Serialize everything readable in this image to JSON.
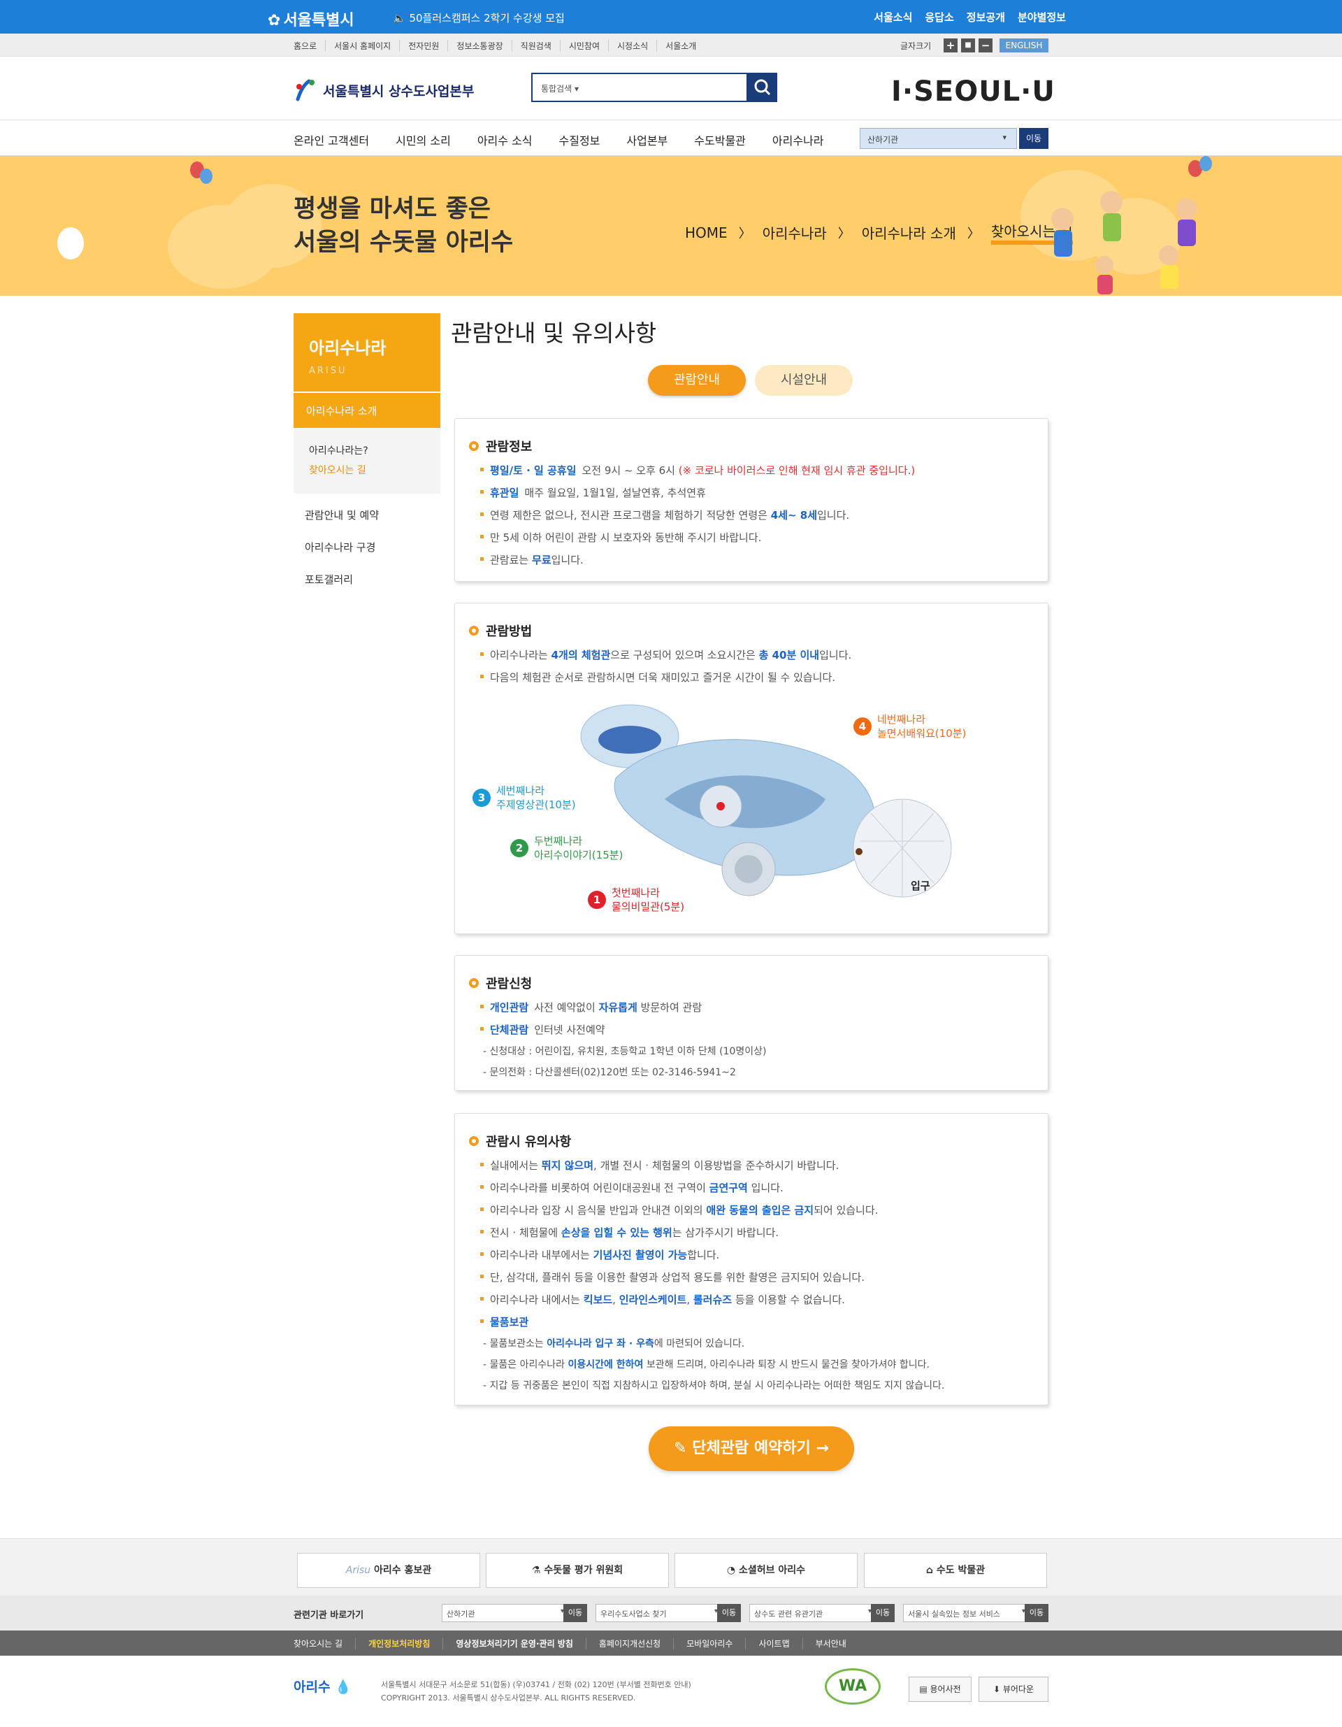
{
  "topbar": {
    "logo": "서울특별시",
    "notice": "50플러스캠퍼스 2학기 수강생 모집",
    "links": [
      "서울소식",
      "응답소",
      "정보공개",
      "분야별정보"
    ]
  },
  "utilbar": {
    "links": [
      "홈으로",
      "서울시 홈페이지",
      "전자민원",
      "정보소통광장",
      "직원검색",
      "시민참여",
      "시정소식",
      "서울소개"
    ],
    "font_size_label": "글자크기",
    "font_plus": "+",
    "font_reset": "■",
    "font_minus": "−",
    "english": "ENGLISH"
  },
  "header": {
    "org_title": "서울특별시 상수도사업본부",
    "search_scope": "통합검색",
    "brand": "I·SEOUL·U"
  },
  "gnb": {
    "items": [
      "온라인 고객센터",
      "시민의 소리",
      "아리수 소식",
      "수질정보",
      "사업본부",
      "수도박물관",
      "아리수나라"
    ],
    "org_select": "산하기관",
    "go": "이동"
  },
  "banner": {
    "slogan_line1": "평생을 마셔도 좋은",
    "slogan_line2": "서울의 수돗물 아리수",
    "breadcrumb": [
      "HOME",
      "아리수나라",
      "아리수나라 소개",
      "찾아오시는 길"
    ]
  },
  "lnb": {
    "title": "아리수나라",
    "subtitle": "ARISU",
    "active": "아리수나라 소개",
    "sub_items": [
      "아리수나라는?",
      "찾아오시는 길"
    ],
    "menu": [
      "관람안내 및 예약",
      "아리수나라 구경",
      "포토갤러리"
    ]
  },
  "content": {
    "page_title": "관람안내 및 유의사항",
    "tabs": [
      "관람안내",
      "시설안내"
    ],
    "info": {
      "title": "관람정보",
      "row1_label": "평일/토 · 일 공휴일",
      "row1_text": "오전 9시 ~ 오후 6시",
      "row1_note": "(※ 코로나 바이러스로 인해 현재 임시 휴관 중입니다.)",
      "row2_label": "휴관일",
      "row2_text": "매주 월요일, 1월1일, 설날연휴, 추석연휴",
      "row3_a": "연령 제한은 없으나, 전시관 프로그램을 체험하기 적당한 연령은",
      "row3_hl": "4세~ 8세",
      "row3_b": "입니다.",
      "row4": "만 5세 이하 어린이 관람 시 보호자와 동반해 주시기 바랍니다.",
      "row5_a": "관람료는",
      "row5_hl": "무료",
      "row5_b": "입니다."
    },
    "method": {
      "title": "관람방법",
      "row1_a": "아리수나라는",
      "row1_hl1": "4개의 체험관",
      "row1_b": "으로 구성되어 있으며 소요시간은",
      "row1_hl2": "총 40분 이내",
      "row1_c": "입니다.",
      "row2": "다음의 체험관 순서로 관람하시면 더욱 재미있고 즐거운 시간이 될 수 있습니다.",
      "stations": [
        {
          "num": "1",
          "line1": "첫번째나라",
          "line2": "물의비밀관(5분)",
          "color": "#e0202a"
        },
        {
          "num": "2",
          "line1": "두번째나라",
          "line2": "아리수이야기(15분)",
          "color": "#2e9a4a"
        },
        {
          "num": "3",
          "line1": "세번째나라",
          "line2": "주제영상관(10분)",
          "color": "#1a9ad6"
        },
        {
          "num": "4",
          "line1": "네번째나라",
          "line2": "놀면서배워요(10분)",
          "color": "#f06a16"
        }
      ],
      "entrance": "입구"
    },
    "apply": {
      "title": "관람신청",
      "row1_label": "개인관람",
      "row1_a": "사전 예약없이",
      "row1_hl": "자유롭게",
      "row1_b": "방문하여 관람",
      "row2_label": "단체관람",
      "row2_text": "인터넷 사전예약",
      "row3": "- 신청대상 : 어린이집, 유치원, 초등학교 1학년 이하 단체 (10명이상)",
      "row4": "- 문의전화 : 다산콜센터(02)120번 또는 02-3146-5941~2"
    },
    "caution": {
      "title": "관람시 유의사항",
      "r1_a": "실내에서는",
      "r1_hl": "뛰지 않으며",
      "r1_b": ", 개별 전시 · 체험물의 이용방법을 준수하시기 바랍니다.",
      "r2_a": "아리수나라를 비롯하여 어린이대공원내 전 구역이",
      "r2_hl": "금연구역",
      "r2_b": " 입니다.",
      "r3_a": "아리수나라 입장 시 음식물 반입과 안내견 이외의",
      "r3_hl": "애완 동물의 출입은 금지",
      "r3_b": "되어 있습니다.",
      "r4_a": "전시 · 체험물에",
      "r4_hl": "손상을 입힐 수 있는 행위",
      "r4_b": "는 삼가주시기 바랍니다.",
      "r5_a": "아리수나라 내부에서는",
      "r5_hl": "기념사진 촬영이 가능",
      "r5_b": "합니다.",
      "r6": "단, 삼각대, 플래쉬 등을 이용한 촬영과 상업적 용도를 위한 촬영은 금지되어 있습니다.",
      "r7_a": "아리수나라 내에서는",
      "r7_hl1": "킥보드",
      "r7_c1": ", ",
      "r7_hl2": "인라인스케이트",
      "r7_c2": ", ",
      "r7_hl3": "롤러슈즈",
      "r7_b": " 등을 이용할 수 없습니다.",
      "r8_hl": "물품보관",
      "r9_a": "- 물품보관소는",
      "r9_hl": "아리수나라 입구 좌 · 우측",
      "r9_b": "에 마련되어 있습니다.",
      "r10_a": "- 물품은 아리수나라",
      "r10_hl": "이용시간에 한하여",
      "r10_b": " 보관해 드리며, 아리수나라 퇴장 시 반드시 물건을 찾아가셔야 합니다.",
      "r11": "- 지갑 등 귀중품은 본인이 직접 지참하시고 입장하셔야 하며, 분실 시 아리수나라는 어떠한 책임도 지지 않습니다."
    },
    "cta": "단체관람 예약하기"
  },
  "footer": {
    "quick_links": [
      "아리수 홍보관",
      "수돗물 평가 위원회",
      "소셜허브 아리수",
      "수도 박물관"
    ],
    "quick_first_mark": "Arisu",
    "related_title": "관련기관 바로가기",
    "related_selects": [
      "산하기관",
      "우리수도사업소 찾기",
      "상수도 관련 유관기관",
      "서울시 실속있는 정보 서비스"
    ],
    "go": "이동",
    "nav": [
      "찾아오시는 길",
      "개인정보처리방침",
      "영상정보처리기기 운영·관리 방침",
      "홈페이지개선신청",
      "모바일아리수",
      "사이트맵",
      "부서안내"
    ],
    "logo": "아리수",
    "address": "서울특별시 서대문구 서소문로 51(합동) (우)03741 / 전화 (02) 120번 (부서별 전화번호 안내)",
    "copyright": "COPYRIGHT 2013. 서울특별시 상수도사업본부. ALL RIGHTS RESERVED.",
    "wa": "WA",
    "btn_glossary": "용어사전",
    "btn_download": "뷰어다운"
  }
}
